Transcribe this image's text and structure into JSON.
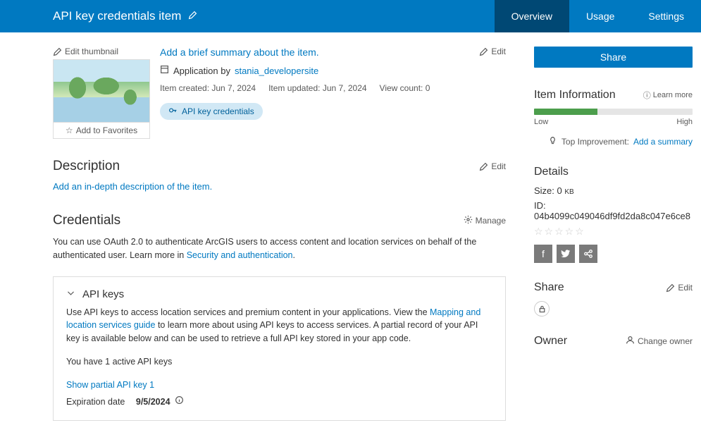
{
  "header": {
    "title": "API key credentials item",
    "tabs": [
      "Overview",
      "Usage",
      "Settings"
    ],
    "active_tab": 0
  },
  "sidebar_button": "Share",
  "item": {
    "edit_thumbnail": "Edit thumbnail",
    "favorite": "Add to Favorites",
    "summary_placeholder": "Add a brief summary about the item.",
    "edit_label": "Edit",
    "application_by": "Application by",
    "author": "stania_developersite",
    "created_label": "Item created:",
    "created": "Jun 7, 2024",
    "updated_label": "Item updated:",
    "updated": "Jun 7, 2024",
    "viewcount_label": "View count:",
    "viewcount": "0",
    "badge": "API key credentials"
  },
  "description": {
    "title": "Description",
    "edit": "Edit",
    "placeholder": "Add an in-depth description of the item."
  },
  "credentials": {
    "title": "Credentials",
    "manage": "Manage",
    "text_a": "You can use OAuth 2.0 to authenticate ArcGIS users to access content and location services on behalf of the authenticated user. Learn more in ",
    "link": "Security and authentication",
    "text_b": "."
  },
  "apikeys": {
    "title": "API keys",
    "body_a": "Use API keys to access location services and premium content in your applications. View the ",
    "body_link": "Mapping and location services guide",
    "body_b": " to learn more about using API keys to access services. A partial record of your API key is available below and can be used to retrieve a full API key stored in your app code.",
    "you_have": "You have 1 active API keys",
    "show_key": "Show partial API key 1",
    "exp_label": "Expiration date",
    "exp_date": "9/5/2024"
  },
  "info": {
    "title": "Item Information",
    "learn_more": "Learn more",
    "progress_pct": 40,
    "low": "Low",
    "high": "High",
    "top_imp_label": "Top Improvement:",
    "top_imp_link": "Add a summary"
  },
  "details": {
    "title": "Details",
    "size_label": "Size:",
    "size_value": "0",
    "size_unit": "KB",
    "id_label": "ID:",
    "id_value": "04b4099c049046df9fd2da8c047e6ce8"
  },
  "share": {
    "title": "Share",
    "edit": "Edit"
  },
  "owner": {
    "title": "Owner",
    "change": "Change owner"
  }
}
